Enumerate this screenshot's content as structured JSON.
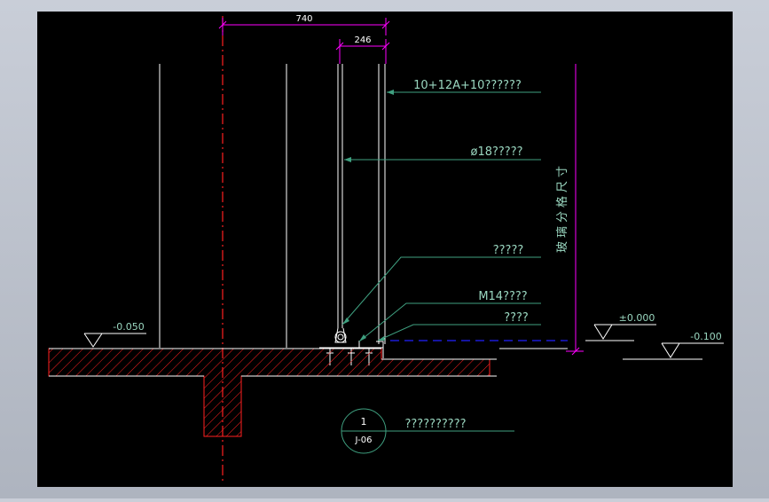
{
  "drawing": {
    "dimensions": {
      "overall_width": "740",
      "profile_width": "246"
    },
    "callouts": {
      "glass_spec": "10+12A+10??????",
      "rod_spec": "ø18?????",
      "part_a": "?????",
      "anchor_bolt": "M14????",
      "part_b": "????"
    },
    "levels": {
      "left_floor": "-0.050",
      "datum": "±0.000",
      "right_floor": "-0.100"
    },
    "vertical_label": "玻璃分格尺寸",
    "detail_marker": {
      "number": "1",
      "sheet": "J-06",
      "title": "??????????"
    },
    "colors": {
      "background": "#000000",
      "frame": "#b8bdc7",
      "dimension": "#ff00ff",
      "leader": "#3fa080",
      "text": "#9ad7c0",
      "centerline": "#ff2020",
      "outline": "#ffffff",
      "hatch": "#ff2020",
      "datum": "#2020ff"
    }
  }
}
